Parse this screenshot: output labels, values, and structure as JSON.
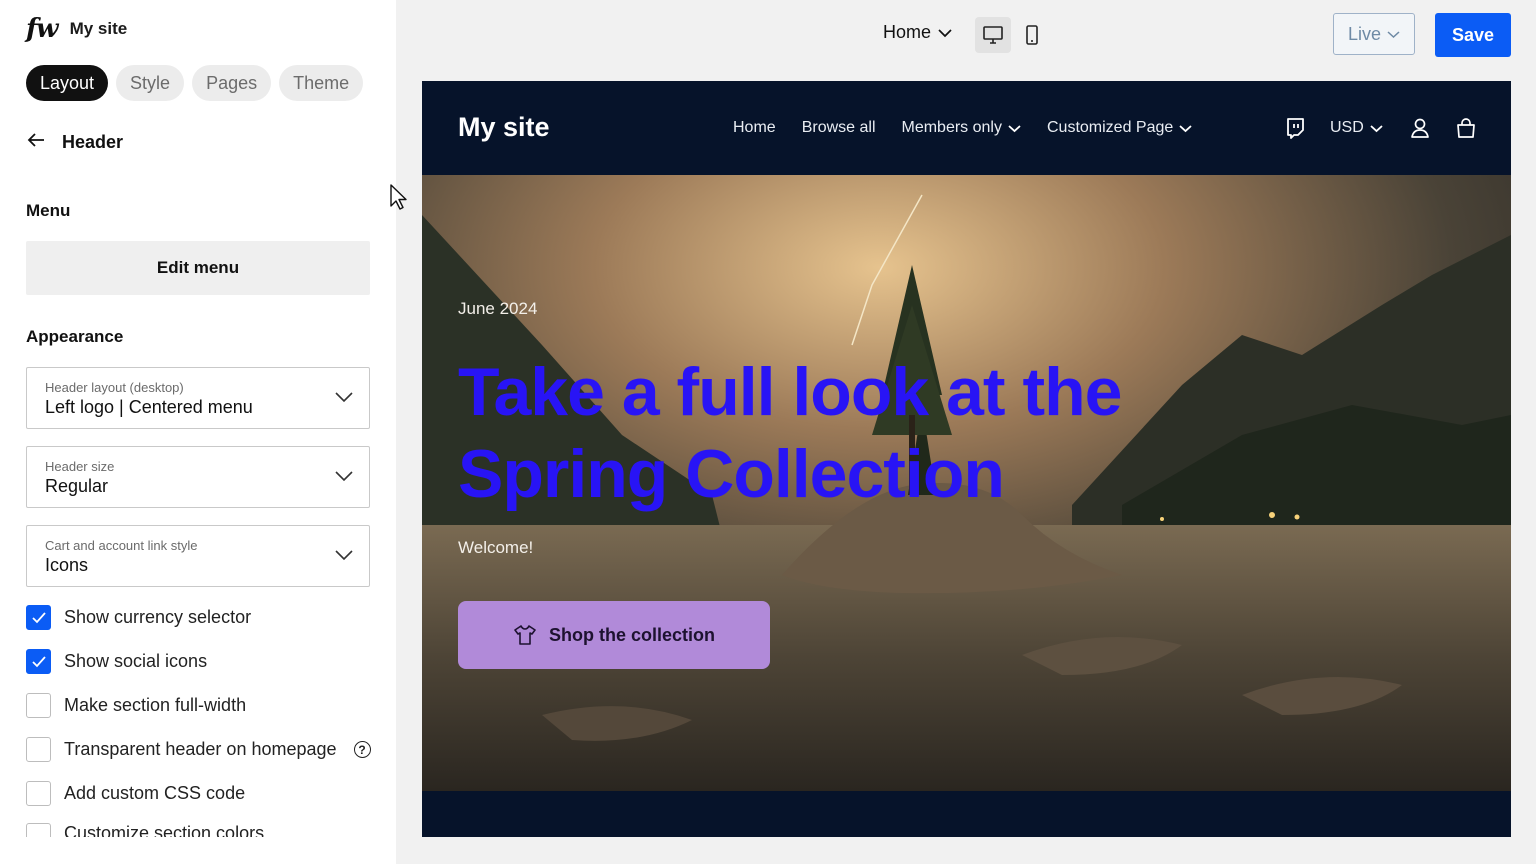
{
  "sidebar": {
    "brand_logo": "fw",
    "site_name": "My site",
    "tabs": [
      {
        "label": "Layout",
        "active": true
      },
      {
        "label": "Style",
        "active": false
      },
      {
        "label": "Pages",
        "active": false
      },
      {
        "label": "Theme",
        "active": false
      }
    ],
    "back_title": "Header",
    "menu_title": "Menu",
    "edit_menu_label": "Edit menu",
    "appearance_title": "Appearance",
    "selects": [
      {
        "label": "Header layout (desktop)",
        "value": "Left logo | Centered menu"
      },
      {
        "label": "Header size",
        "value": "Regular"
      },
      {
        "label": "Cart and account link style",
        "value": "Icons"
      }
    ],
    "checkboxes": [
      {
        "label": "Show currency selector",
        "checked": true
      },
      {
        "label": "Show social icons",
        "checked": true
      },
      {
        "label": "Make section full-width",
        "checked": false
      },
      {
        "label": "Transparent header on homepage",
        "checked": false
      },
      {
        "label": "Add custom CSS code",
        "checked": false
      },
      {
        "label": "Customize section colors",
        "checked": false
      }
    ]
  },
  "topbar": {
    "page_select": "Home",
    "live_label": "Live",
    "save_label": "Save"
  },
  "preview": {
    "site_logo": "My site",
    "nav": [
      "Home",
      "Browse all",
      "Members only",
      "Customized Page"
    ],
    "currency": "USD",
    "hero": {
      "date": "June 2024",
      "title": "Take a full look at the Spring Collection",
      "subtitle": "Welcome!",
      "cta_label": "Shop the collection"
    }
  },
  "colors": {
    "accent": "#0b5cf5",
    "header_bg": "#06132a",
    "hero_title": "#2814f5",
    "cta_bg": "#b18ad9"
  }
}
